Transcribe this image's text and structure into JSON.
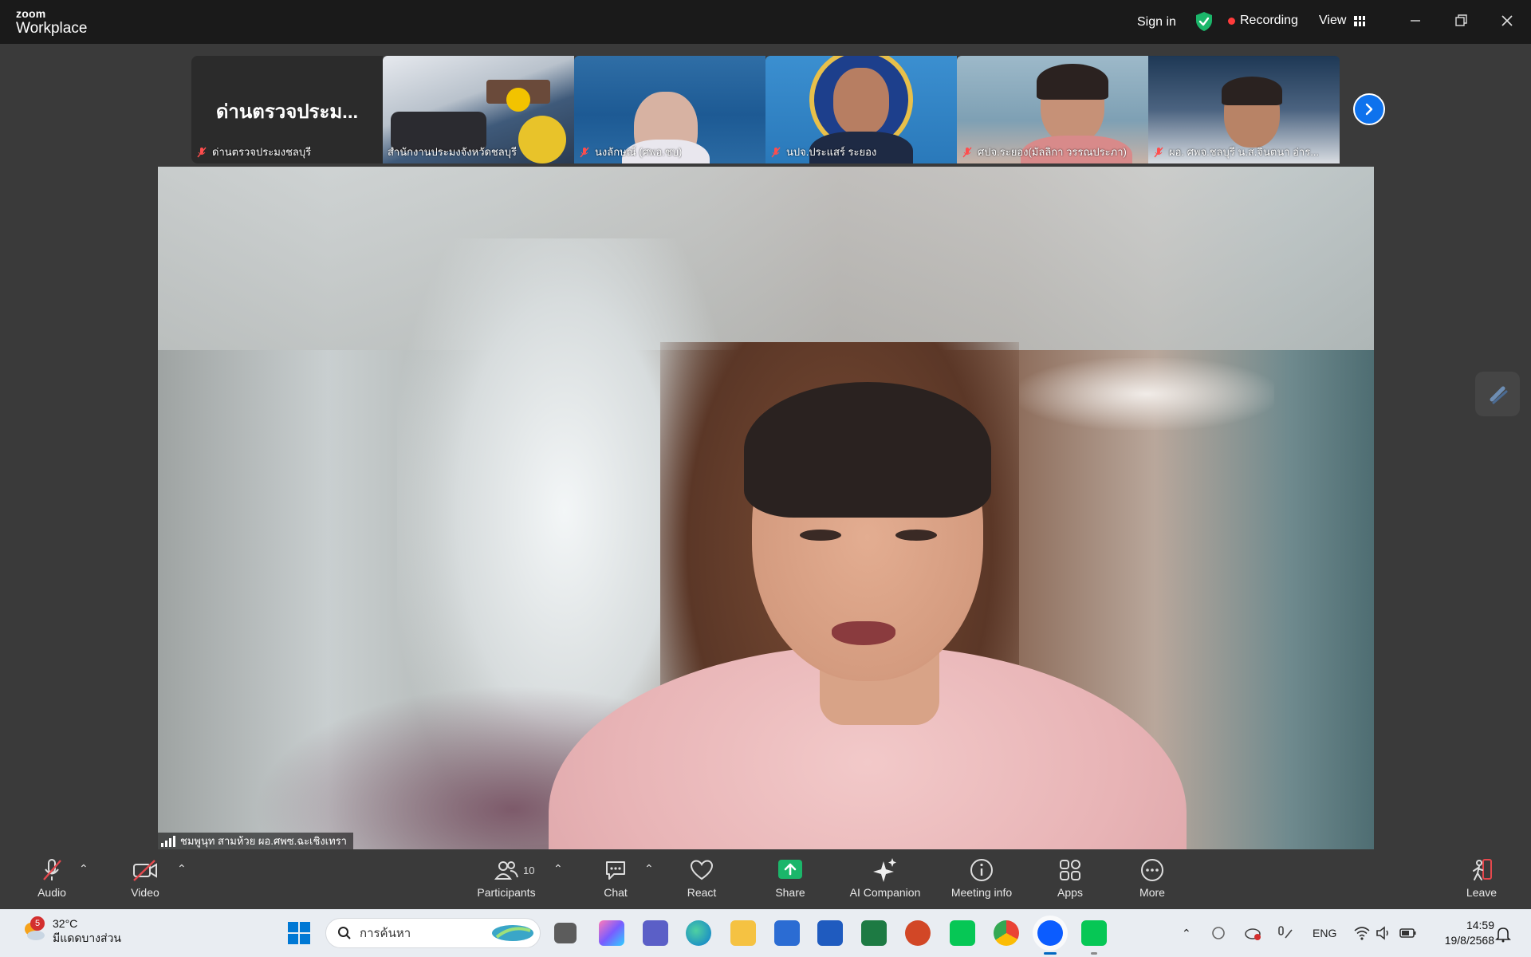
{
  "app": {
    "logo_top": "zoom",
    "logo_bottom": "Workplace",
    "sign_in": "Sign in",
    "recording": "Recording",
    "view": "View"
  },
  "filmstrip": {
    "tiles": [
      {
        "name": "ด่านตรวจประมงชลบุรี",
        "display_text": "ด่านตรวจประม..."
      },
      {
        "name": "สำนักงานประมงจังหวัดชลบุรี"
      },
      {
        "name": "นงลักษณ์ (ศพอ.ชบ)"
      },
      {
        "name": "นปจ.ประแสร์ ระยอง"
      },
      {
        "name": "ศปจ.ระยอง(มัลลิกา วรรณประภา)"
      },
      {
        "name": "ผอ. ศพจ.ชลบุรี น.ส.จินตนา อ่าร..."
      }
    ]
  },
  "main_video": {
    "speaker_name": "ชมพูนุท สามห้วย ผอ.ศพซ.ฉะเชิงเทรา"
  },
  "toolbar": {
    "audio": "Audio",
    "video": "Video",
    "participants": "Participants",
    "participants_count": "10",
    "chat": "Chat",
    "react": "React",
    "share": "Share",
    "ai_companion": "AI Companion",
    "meeting_info": "Meeting info",
    "apps": "Apps",
    "more": "More",
    "leave": "Leave"
  },
  "taskbar": {
    "weather_badge": "5",
    "temperature": "32°C",
    "weather_desc": "มีแดดบางส่วน",
    "search_placeholder": "การค้นหา",
    "language": "ENG",
    "time": "14:59",
    "date": "19/8/2568"
  },
  "colors": {
    "accent": "#0e72ed",
    "share_green": "#1bb66a",
    "recording_red": "#ff3b3b",
    "titlebar": "#1a1a1a",
    "toolbar": "#3a3a3a"
  }
}
